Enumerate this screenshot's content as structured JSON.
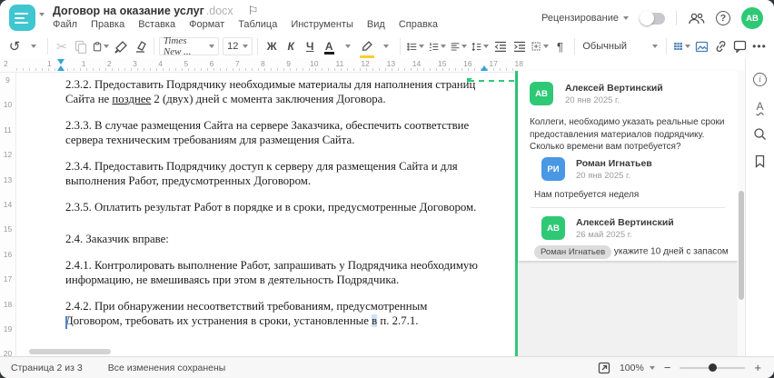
{
  "window": {
    "title": "Договор на оказание услуг",
    "title_ext": ".docx"
  },
  "menu": {
    "items": [
      "Файл",
      "Правка",
      "Вставка",
      "Формат",
      "Таблица",
      "Инструменты",
      "Вид",
      "Справка"
    ]
  },
  "header_right": {
    "review_label": "Рецензирование",
    "avatar_initials": "АВ"
  },
  "toolbar": {
    "font_name": "Times New ...",
    "font_size": "12",
    "bold_label": "Ж",
    "italic_label": "К",
    "underline_label": "Ч",
    "font_color_label": "А",
    "pilcrow_label": "¶",
    "style_name": "Обычный",
    "more_label": "•••"
  },
  "ruler": {
    "h_margin_numbers": [
      "2",
      "1"
    ],
    "h_numbers": [
      "1",
      "2",
      "3",
      "4",
      "5",
      "6",
      "7",
      "8",
      "9",
      "10",
      "11",
      "12",
      "13",
      "14",
      "15",
      "16",
      "17",
      "18"
    ],
    "v_numbers": [
      "9",
      "10",
      "11",
      "12",
      "13",
      "14",
      "15",
      "16",
      "17",
      "18",
      "19",
      "20"
    ]
  },
  "document": {
    "p1_before": "2.3.2. Предоставить Подрядчику необходимые материалы для наполнения страниц Сайта не ",
    "p1_commented": "позднее",
    "p1_after": " 2 (двух) дней с момента заключения Договора.",
    "p2": "2.3.3. В случае размещения Сайта на сервере Заказчика, обеспечить соответствие сервера техническим требованиям для размещения Сайта.",
    "p3": "2.3.4. Предоставить Подрядчику доступ к серверу для размещения Сайта и для выполнения Работ, предусмотренных Договором.",
    "p4": "2.3.5. Оплатить результат Работ в порядке и в сроки, предусмотренные Договором.",
    "p5": "2.4. Заказчик вправе:",
    "p6": "2.4.1. Контролировать выполнение Работ, запрашивать у Подрядчика необходимую информацию, не вмешиваясь при этом в деятельность Подрядчика.",
    "p7_before": "2.4.2. При обнаружении несоответствий требованиям, предусмотренным Договором, требовать их устранения в сроки, установленные ",
    "p7_highlight": "в",
    "p7_after": " п. 2.7.1."
  },
  "comments": {
    "thread": [
      {
        "initials": "АВ",
        "name": "Алексей Вертинский",
        "date": "20 янв 2025 г.",
        "text": "Коллеги, необходимо указать реальные сроки предоставления материалов подрядчику. Сколько времени вам потребуется?"
      },
      {
        "initials": "РИ",
        "name": "Роман Игнатьев",
        "date": "20 янв 2025 г.",
        "text": "Нам потребуется неделя"
      },
      {
        "initials": "АВ",
        "name": "Алексей Вертинский",
        "date": "26 май 2025 г.",
        "mention": "Роман Игнатьев",
        "text": " укажите 10 дней с запасом"
      }
    ]
  },
  "statusbar": {
    "page_info": "Страница 2 из 3",
    "saved_info": "Все изменения сохранены",
    "zoom_value": "100%"
  },
  "colors": {
    "accent_teal": "#3fc6d1",
    "green": "#2fc976",
    "blue_avatar": "#4a97e4",
    "highlight_yellow": "#fccd32",
    "toolbar_blue": "#4a7fb5",
    "marker_blue": "#35a3dc"
  }
}
